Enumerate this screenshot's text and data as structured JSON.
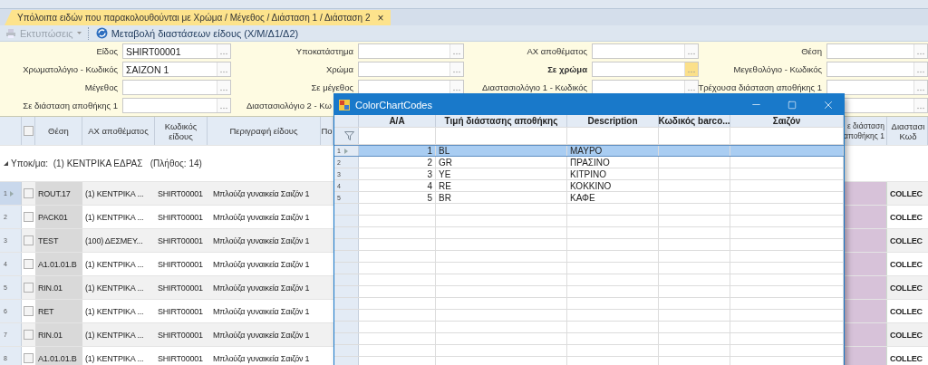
{
  "tab": {
    "title": "Υπόλοιπα ειδών που παρακολουθούνται με Χρώμα / Μέγεθος / Διάσταση 1  / Διάσταση 2",
    "close": "×",
    "selected": true
  },
  "toolbar": [
    {
      "label": "Εκτυπώσεις",
      "kind": "dropdown",
      "disabled": true
    },
    {
      "label": "Μεταβολή διαστάσεων είδους (Χ/Μ/Δ1/Δ2)",
      "kind": "action",
      "disabled": false
    }
  ],
  "filters": [
    [
      {
        "kind": "labeled",
        "label": "Είδος",
        "value": "SHIRT00001",
        "highlighted": false
      },
      {
        "kind": "labeled",
        "label": "Υποκατάστημα",
        "highlighted": false
      },
      {
        "kind": "labeled",
        "label": "ΑΧ αποθέματος",
        "highlighted": false
      },
      {
        "kind": "labeled",
        "label": "Θέση",
        "highlighted": false
      }
    ],
    [
      {
        "kind": "labeled",
        "label": "Χρωματολόγιο - Κωδικός",
        "value": "ΣΑΙΖΟΝ 1",
        "highlighted": false
      },
      {
        "kind": "labeled",
        "label": "Χρώμα",
        "highlighted": false
      },
      {
        "kind": "labeled",
        "label": "Σε χρώμα",
        "highlighted": true
      },
      {
        "kind": "labeled",
        "label": "Μεγεθολόγιο - Κωδικός",
        "highlighted": false
      }
    ],
    [
      {
        "kind": "labeled",
        "label": "Μέγεθος",
        "highlighted": false
      },
      {
        "kind": "labeled",
        "label": "Σε μέγεθος",
        "highlighted": false
      },
      {
        "kind": "labeled",
        "label": "Διαστασιολόγιο 1 - Κωδικός",
        "highlighted": false
      },
      {
        "kind": "labeled",
        "label": "Τρέχουσα διάσταση αποθήκης 1",
        "highlighted": false
      }
    ],
    [
      {
        "kind": "labeled",
        "label": "Σε διάσταση αποθήκης 1",
        "highlighted": false
      },
      {
        "kind": "label_only",
        "label": "Διαστασιολόγιο 2 - Κω",
        "highlighted": false
      },
      {
        "kind": "field_only",
        "highlighted": false
      }
    ]
  ],
  "grid": {
    "select_all_checked": false,
    "columns": [
      "Θέση",
      "ΑΧ αποθέματος",
      "Κωδικός είδους",
      "Περιγραφή είδους",
      "Πο"
    ],
    "right_columns": [
      [
        "ε διάσταση",
        "αποθήκης 1"
      ],
      [
        "Διαστασι",
        "Κωδ"
      ]
    ],
    "group": "Υποκ/μα:  (1) ΚΕΝΤΡΙΚΑ ΕΔΡΑΣ   (Πλήθος: 14)",
    "rows": [
      {
        "num": "1",
        "current": true,
        "checked": false,
        "cells": [
          "ROUT.17",
          "(1) ΚΕΝΤΡΙΚΑ ...",
          "SHIRT00001",
          "Μπλούζα γυναικεία Σαιζόν 1"
        ],
        "last": "COLLEC"
      },
      {
        "num": "2",
        "current": false,
        "checked": false,
        "cells": [
          "PACK01",
          "(1) ΚΕΝΤΡΙΚΑ ...",
          "SHIRT00001",
          "Μπλούζα γυναικεία Σαιζόν 1"
        ],
        "last": "COLLEC"
      },
      {
        "num": "3",
        "current": false,
        "checked": false,
        "cells": [
          "TEST",
          "(100) ΔΕΣΜΕΥ...",
          "SHIRT00001",
          "Μπλούζα γυναικεία Σαιζόν 1"
        ],
        "last": "COLLEC"
      },
      {
        "num": "4",
        "current": false,
        "checked": false,
        "cells": [
          "A1.01.01.B",
          "(1) ΚΕΝΤΡΙΚΑ ...",
          "SHIRT00001",
          "Μπλούζα γυναικεία Σαιζόν 1"
        ],
        "last": "COLLEC"
      },
      {
        "num": "5",
        "current": false,
        "checked": false,
        "cells": [
          "RIN.01",
          "(1) ΚΕΝΤΡΙΚΑ ...",
          "SHIRT00001",
          "Μπλούζα γυναικεία Σαιζόν 1"
        ],
        "last": "COLLEC"
      },
      {
        "num": "6",
        "current": false,
        "checked": false,
        "cells": [
          "RET",
          "(1) ΚΕΝΤΡΙΚΑ ...",
          "SHIRT00001",
          "Μπλούζα γυναικεία Σαιζόν 1"
        ],
        "last": "COLLEC"
      },
      {
        "num": "7",
        "current": false,
        "checked": false,
        "cells": [
          "RIN.01",
          "(1) ΚΕΝΤΡΙΚΑ ...",
          "SHIRT00001",
          "Μπλούζα γυναικεία Σαιζόν 1"
        ],
        "last": "COLLEC"
      },
      {
        "num": "8",
        "current": false,
        "checked": false,
        "cells": [
          "A1.01.01.B",
          "(1) ΚΕΝΤΡΙΚΑ ...",
          "SHIRT00001",
          "Μπλούζα γυναικεία Σαιζόν 1"
        ],
        "last": "COLLEC"
      }
    ]
  },
  "dialog": {
    "title": "ColorChartCodes",
    "columns": [
      "Α/Α",
      "Τιμή διάστασης αποθήκης",
      "Description",
      "Κωδικός barco...",
      "Σαιζόν"
    ],
    "rows": [
      {
        "num": "1",
        "selected": true,
        "aa": "1",
        "value": "BL",
        "description": "ΜΑΥΡΟ"
      },
      {
        "num": "2",
        "selected": false,
        "aa": "2",
        "value": "GR",
        "description": "ΠΡΑΣΙΝΟ"
      },
      {
        "num": "3",
        "selected": false,
        "aa": "3",
        "value": "YE",
        "description": "ΚΙΤΡΙΝΟ"
      },
      {
        "num": "4",
        "selected": false,
        "aa": "4",
        "value": "RE",
        "description": "ΚΟΚΚΙΝΟ"
      },
      {
        "num": "5",
        "selected": false,
        "aa": "5",
        "value": "BR",
        "description": "ΚΑΦΕ"
      }
    ]
  }
}
